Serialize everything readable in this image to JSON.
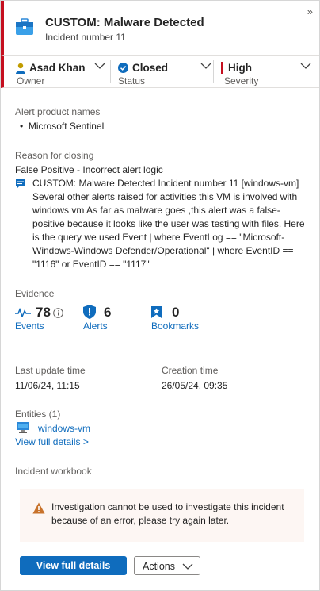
{
  "header": {
    "title": "CUSTOM: Malware Detected",
    "subtitle": "Incident number 11",
    "collapse_glyph": "»",
    "icon": "incident-briefcase-icon",
    "severity_color": "#c50f1f"
  },
  "owner": {
    "value": "Asad Khan",
    "label": "Owner",
    "icon": "person-icon"
  },
  "status": {
    "value": "Closed",
    "label": "Status",
    "icon": "check-circle-icon"
  },
  "severity": {
    "value": "High",
    "label": "Severity",
    "icon": "severity-bar-icon"
  },
  "alert_products": {
    "label": "Alert product names",
    "items": [
      "Microsoft Sentinel"
    ]
  },
  "closing": {
    "label": "Reason for closing",
    "reason": "False Positive - Incorrect alert logic",
    "comment_lines": [
      "CUSTOM: Malware Detected Incident number 11 [windows-vm]",
      "Several other alerts raised for activities this VM is involved with",
      "windows vm As far as malware goes ,this alert was a false-",
      "positive because it looks like the user was testing with files. Here",
      "is the query we used Event | where EventLog == \"Microsoft-",
      "Windows-Windows Defender/Operational\" | where EventID ==",
      "\"1116\" or EventID == \"1117\""
    ]
  },
  "evidence": {
    "label": "Evidence",
    "events": {
      "count": "78",
      "label": "Events"
    },
    "alerts": {
      "count": "6",
      "label": "Alerts"
    },
    "bookmarks": {
      "count": "0",
      "label": "Bookmarks"
    }
  },
  "times": {
    "last_update_label": "Last update time",
    "last_update_value": "11/06/24, 11:15",
    "creation_label": "Creation time",
    "creation_value": "26/05/24, 09:35"
  },
  "entities": {
    "label": "Entities (1)",
    "items": [
      "windows-vm"
    ],
    "view_link": "View full details >"
  },
  "workbook": {
    "label": "Incident workbook"
  },
  "warning": {
    "lines": [
      "Investigation cannot be used to investigate this incident",
      "because of an error, please try again later."
    ]
  },
  "footer": {
    "primary_label": "View full details",
    "actions_label": "Actions"
  },
  "colors": {
    "link": "#0f6cbd",
    "severity_high": "#c50f1f",
    "warning_bg": "#fdf6f3",
    "warning_icon": "#c8722b"
  }
}
